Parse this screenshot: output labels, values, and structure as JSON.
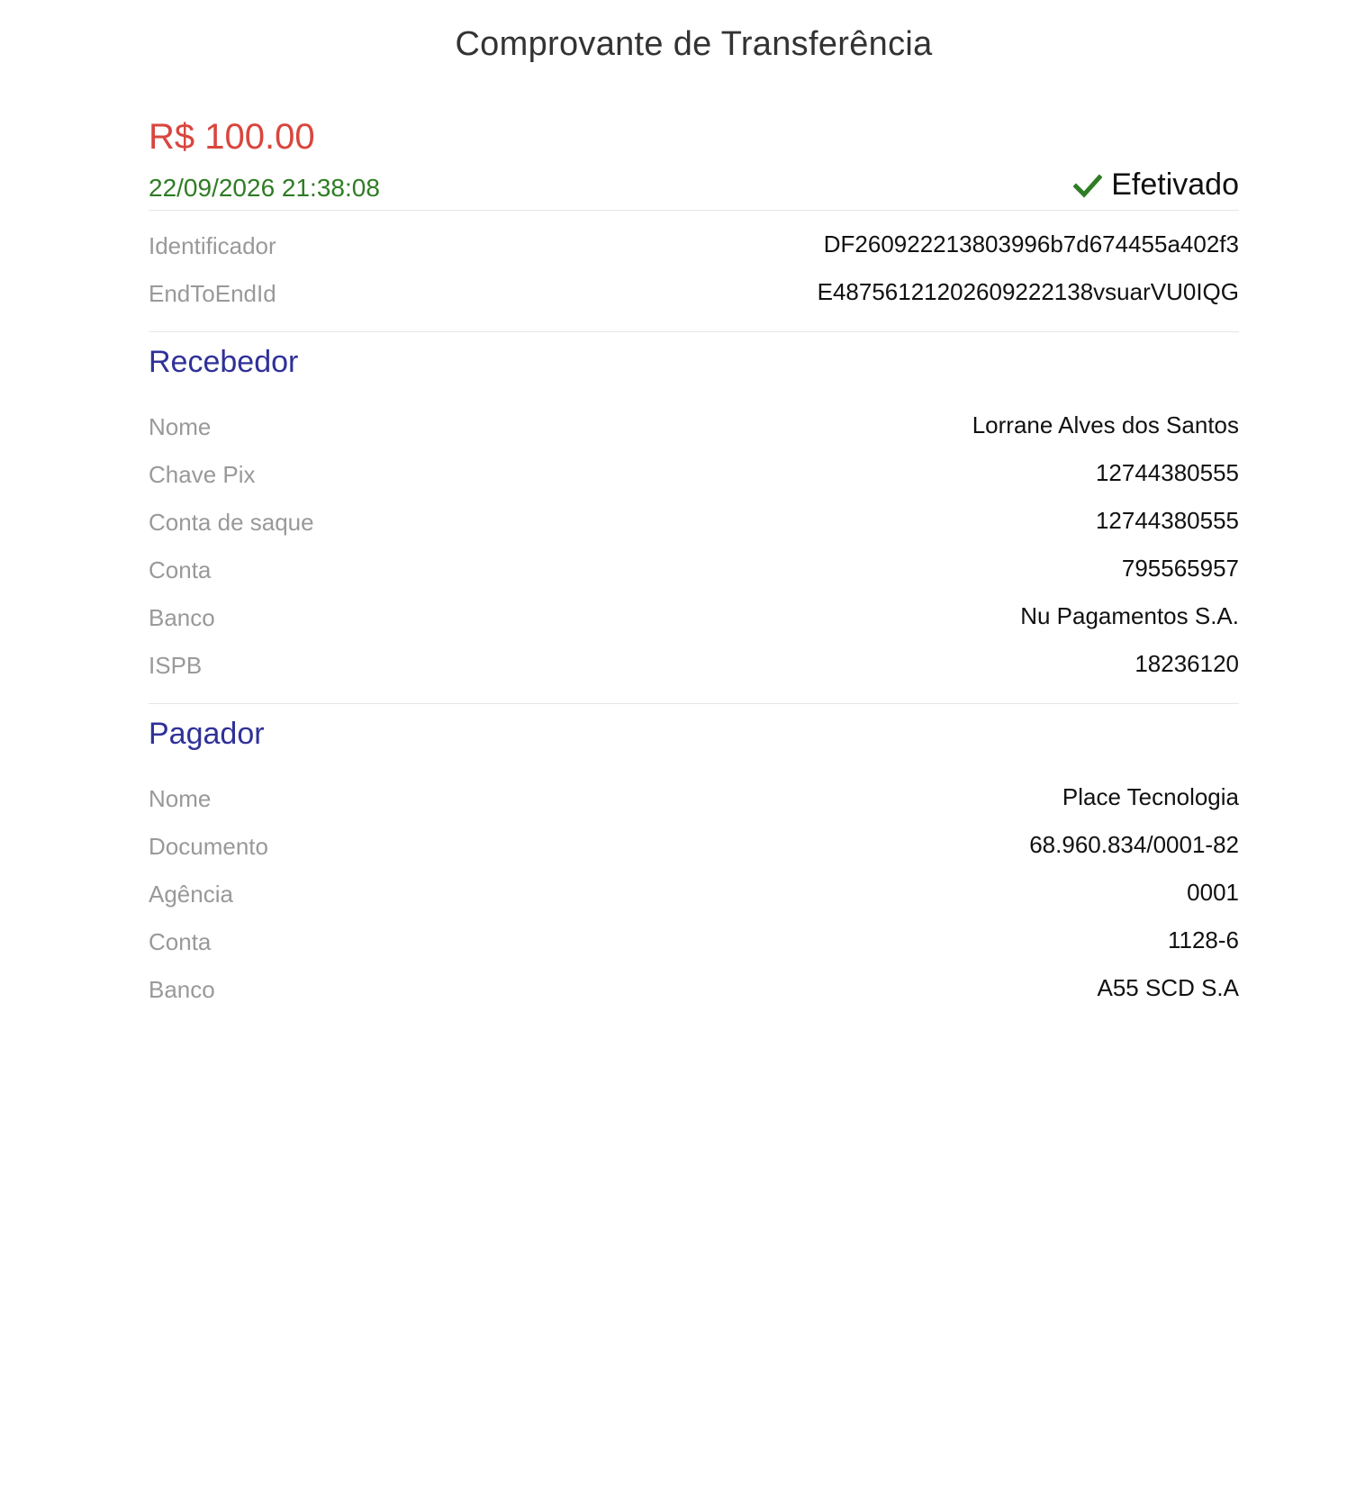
{
  "header": {
    "title": "Comprovante de Transferência"
  },
  "summary": {
    "amount": "R$ 100.00",
    "datetime": "22/09/2026 21:38:08",
    "status": "Efetivado"
  },
  "ids": [
    {
      "label": "Identificador",
      "value": "DF260922213803996b7d674455a402f3"
    },
    {
      "label": "EndToEndId",
      "value": "E48756121202609222138vsuarVU0IQG"
    }
  ],
  "recebedor": {
    "title": "Recebedor",
    "rows": [
      {
        "label": "Nome",
        "value": "Lorrane Alves dos Santos"
      },
      {
        "label": "Chave Pix",
        "value": "12744380555"
      },
      {
        "label": "Conta de saque",
        "value": "12744380555"
      },
      {
        "label": "Conta",
        "value": "795565957"
      },
      {
        "label": "Banco",
        "value": "Nu Pagamentos S.A."
      },
      {
        "label": "ISPB",
        "value": "18236120"
      }
    ]
  },
  "pagador": {
    "title": "Pagador",
    "rows": [
      {
        "label": "Nome",
        "value": "Place Tecnologia"
      },
      {
        "label": "Documento",
        "value": "68.960.834/0001-82"
      },
      {
        "label": "Agência",
        "value": "0001"
      },
      {
        "label": "Conta",
        "value": "1128-6"
      },
      {
        "label": "Banco",
        "value": "A55 SCD S.A"
      }
    ]
  },
  "colors": {
    "amount": "#d9463e",
    "datetime": "#2e7d24",
    "status_icon": "#2e7d24",
    "section_title": "#2f3199",
    "label": "#999999",
    "value": "#111111"
  },
  "icons": {
    "status": "checkmark-icon"
  }
}
